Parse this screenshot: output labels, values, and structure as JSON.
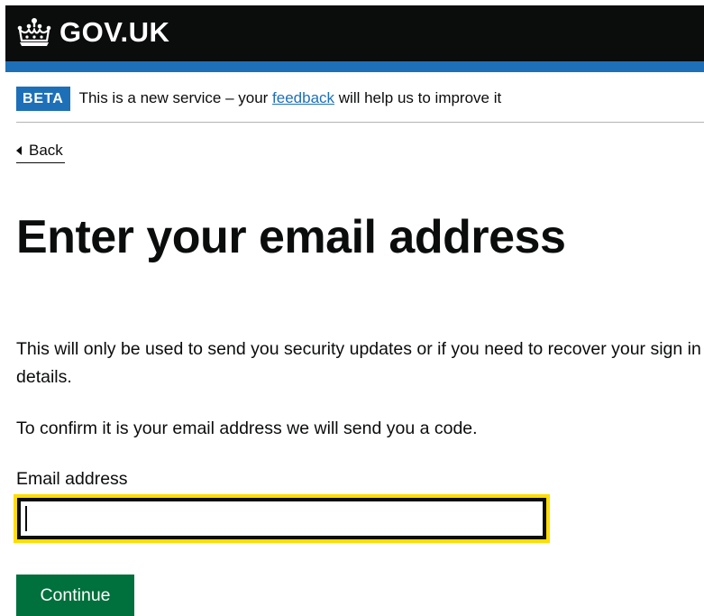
{
  "header": {
    "logo_text": "GOV.UK",
    "logo_icon": "crown-icon",
    "background_color": "#0b0c0c",
    "accent_bar_color": "#1d70b8"
  },
  "phase_banner": {
    "tag": "BETA",
    "text_before": "This is a new service – your ",
    "link_text": "feedback",
    "text_after": " will help us to improve it"
  },
  "back_link": {
    "label": "Back",
    "icon": "chevron-left-icon"
  },
  "main": {
    "title": "Enter your email address",
    "paragraph_1": "This will only be used to send you security updates or if you need to recover your sign in details.",
    "paragraph_2": "To confirm it is your email address we will send you a code."
  },
  "form": {
    "email_label": "Email address",
    "email_value": "",
    "focus_color": "#ffdd00",
    "submit_label": "Continue",
    "submit_color": "#00703c"
  }
}
